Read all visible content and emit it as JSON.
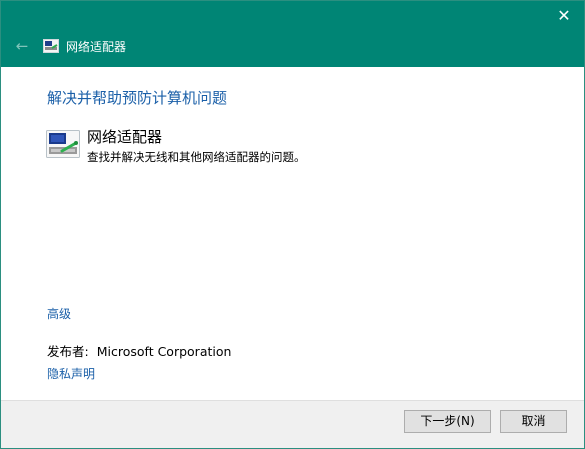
{
  "window": {
    "title": "网络适配器",
    "close_glyph": "✕",
    "back_glyph": "←",
    "title_icon": "network-adapter-icon",
    "accent_color": "#008575"
  },
  "main": {
    "heading": "解决并帮助预防计算机问题",
    "item": {
      "icon": "network-adapter-icon",
      "title": "网络适配器",
      "description": "查找并解决无线和其他网络适配器的问题。"
    },
    "advanced_link": "高级",
    "publisher_label": "发布者:",
    "publisher_name": "Microsoft Corporation",
    "privacy_link": "隐私声明",
    "link_color": "#1a5fa8"
  },
  "footer": {
    "next_label": "下一步(N)",
    "cancel_label": "取消"
  }
}
